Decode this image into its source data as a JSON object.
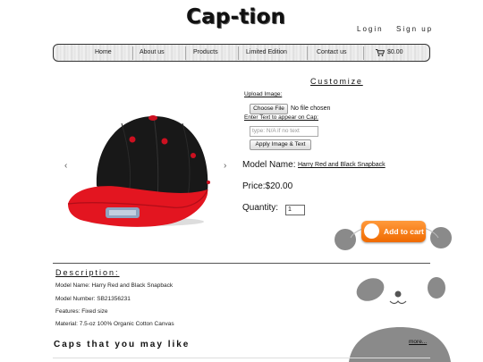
{
  "header": {
    "logo": "Cap-tion",
    "login": "Login",
    "signup": "Sign up"
  },
  "nav": {
    "items": [
      "Home",
      "About us",
      "Products",
      "Limited Edition",
      "Contact us"
    ],
    "cart_total": "$0.00"
  },
  "carousel": {
    "prev_label": "‹",
    "next_label": "›"
  },
  "customize": {
    "title": "Customize",
    "upload_label": "Upload Image:",
    "choose_button": "Choose File",
    "no_file": "No file chosen",
    "text_label": "Enter Text to appear on Cap:",
    "text_placeholder": "type: N/A if no text",
    "apply_button": "Apply Image & Text"
  },
  "product": {
    "model_label": "Model Name:",
    "model_name": "Harry Red and Black Snapback",
    "price": "Price:$20.00",
    "quantity_label": "Quantity:",
    "quantity_value": "1",
    "add_to_cart": "Add to cart"
  },
  "description": {
    "title": "Description:",
    "lines": [
      "Model Name: Harry Red and Black Snapback",
      "Model Number: SB21356231",
      "Features: Fixed size",
      "Material: 7.5-oz 100% Organic Cotton Canvas"
    ]
  },
  "related": {
    "title": "Caps that you may like",
    "more": "more..."
  },
  "colors": {
    "accent_orange": "#f07a10",
    "cap_red": "#e0141e",
    "cap_black": "#151515",
    "panda_gray": "#8a8a8a"
  }
}
